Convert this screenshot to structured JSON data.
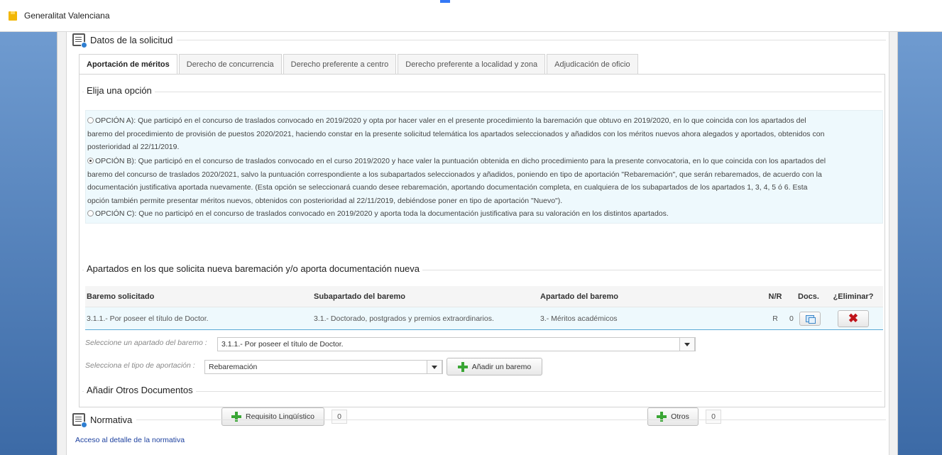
{
  "window": {
    "title": "Generalitat Valenciana"
  },
  "datos": {
    "title": "Datos de la solicitud",
    "tabs": [
      {
        "label": "Aportación de méritos",
        "active": true
      },
      {
        "label": "Derecho de concurrencia",
        "active": false
      },
      {
        "label": "Derecho preferente a centro",
        "active": false
      },
      {
        "label": "Derecho preferente a localidad y zona",
        "active": false
      },
      {
        "label": "Adjudicación de oficio",
        "active": false
      }
    ],
    "elija": {
      "legend": "Elija una opción",
      "options": [
        {
          "checked": false,
          "lines": [
            "OPCIÓN A): Que participó en el concurso de traslados convocado en 2019/2020 y opta por hacer valer en el presente procedimiento la baremación que obtuvo en 2019/2020, en lo que coincida con los apartados del",
            "baremo del procedimiento de provisión de puestos 2020/2021, haciendo constar en la presente solicitud telemática los apartados seleccionados y añadidos con los méritos nuevos ahora alegados y aportados, obtenidos con",
            "posterioridad al 22/11/2019."
          ]
        },
        {
          "checked": true,
          "lines": [
            "OPCIÓN B): Que participó en el concurso de traslados convocado en el curso 2019/2020 y hace valer la puntuación obtenida en dicho procedimiento para la presente convocatoria, en lo que coincida con los apartados del",
            "baremo del concurso de traslados 2020/2021, salvo la puntuación correspondiente a los subapartados seleccionados y añadidos, poniendo en tipo de aportación \"Rebaremación\", que serán rebaremados, de acuerdo con la",
            "documentación justificativa aportada nuevamente. (Esta opción se seleccionará cuando desee rebaremación, aportando documentación completa, en cualquiera de los subapartados de los apartados 1, 3, 4, 5 ó 6. Esta",
            "opción también permite presentar méritos nuevos, obtenidos con posterioridad al 22/11/2019, debiéndose poner en tipo de aportación \"Nuevo\")."
          ]
        },
        {
          "checked": false,
          "lines": [
            "OPCIÓN C): Que no participó en el concurso de traslados convocado en 2019/2020 y aporta toda la documentación justificativa para su valoración en los distintos apartados."
          ]
        }
      ]
    },
    "apartados": {
      "legend": "Apartados en los que solicita nueva baremación y/o aporta documentación nueva",
      "headers": {
        "baremo": "Baremo solicitado",
        "subapartado": "Subapartado del baremo",
        "apartado": "Apartado del baremo",
        "nr": "N/R",
        "docs": "Docs.",
        "eliminar": "¿Eliminar?"
      },
      "rows": [
        {
          "baremo": "3.1.1.- Por poseer el título de Doctor.",
          "subapartado": "3.1.- Doctorado, postgrados y premios extraordinarios.",
          "apartado": "3.- Méritos académicos",
          "nr": "R",
          "docs": "0"
        }
      ],
      "select_apartado": {
        "label": "Seleccione un apartado del baremo :",
        "value": "3.1.1.- Por poseer el título de Doctor."
      },
      "select_tipo": {
        "label": "Selecciona el tipo de aportación :",
        "value": "Rebaremación"
      },
      "add_button": "Añadir un baremo"
    },
    "otros_docs": {
      "legend": "Añadir Otros Documentos",
      "requisito_button": "Requisito Lingüístico",
      "requisito_count": "0",
      "otros_button": "Otros",
      "otros_count": "0"
    }
  },
  "normativa": {
    "title": "Normativa",
    "link": "Acceso al detalle de la normativa"
  },
  "colors": {
    "accent": "#3478f6",
    "selected_row": "#eef9fd",
    "delete": "#c0141b",
    "add": "#3aa635"
  }
}
